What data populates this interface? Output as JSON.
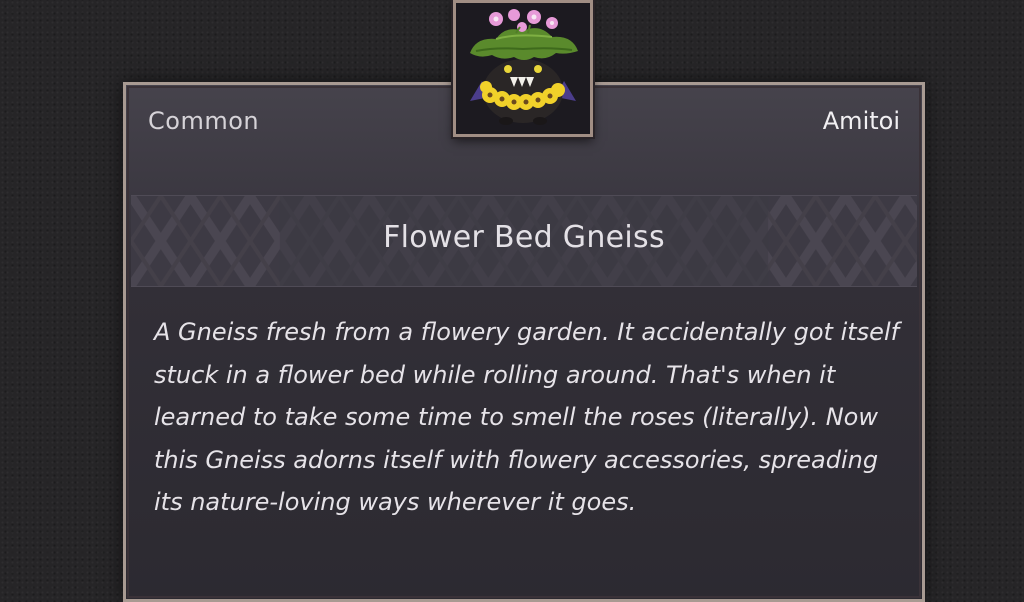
{
  "item": {
    "rarity": "Common",
    "category": "Amitoi",
    "name": "Flower Bed Gneiss",
    "description": "A Gneiss fresh from a flowery garden. It accidentally got itself stuck in a flower bed while rolling around. That's when it learned to take some time to smell the roses (literally). Now this Gneiss adorns itself with flowery accessories, spreading its nature-loving ways wherever it goes."
  },
  "colors": {
    "frame_border": "#a89a92",
    "panel_top": "#46434c",
    "panel_bottom": "#2c2a31",
    "name_band": "#3d3a44",
    "text": "#e6e3e8"
  },
  "portrait": {
    "icon": "flower-bed-gneiss-icon"
  }
}
